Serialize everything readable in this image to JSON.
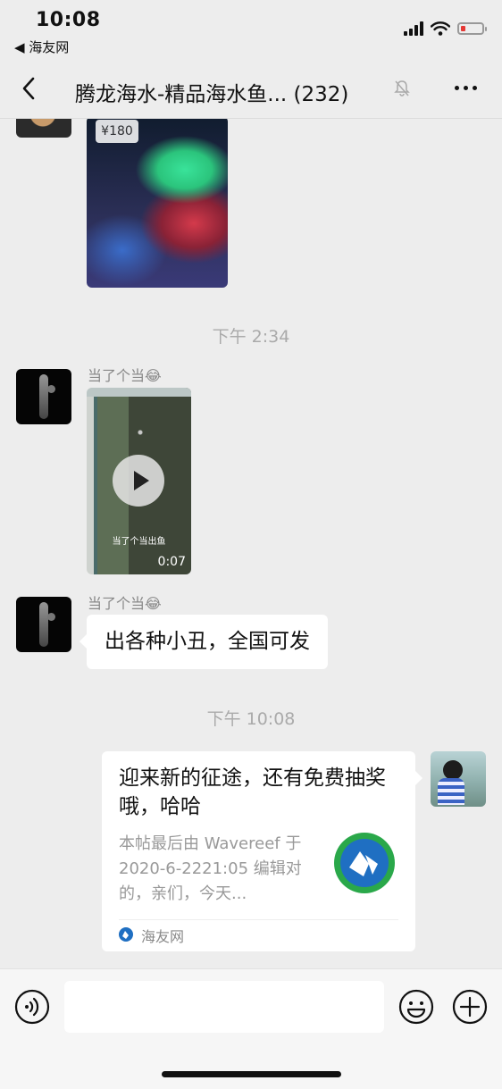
{
  "status": {
    "time": "10:08",
    "back_app": "◀ 海友网"
  },
  "nav": {
    "title": "腾龙海水-精品海水鱼... (232)"
  },
  "messages": {
    "photo_label": "¥180",
    "time1": "下午 2:34",
    "msg1_sender": "当了个当😂",
    "video_caption": "当了个当出鱼",
    "video_duration": "0:07",
    "msg2_sender": "当了个当😂",
    "msg2_text": "出各种小丑，全国可发",
    "time2": "下午 10:08",
    "card": {
      "title": "迎来新的征途，还有免费抽奖哦，哈哈",
      "desc": "本帖最后由 Wavereef 于 2020-6-2221:05 编辑对的，亲们，今天...",
      "source": "海友网"
    }
  },
  "colors": {
    "background": "#ededed",
    "bubble": "#ffffff",
    "logo_blue": "#1f6fc2",
    "logo_green": "#2aa84a"
  }
}
